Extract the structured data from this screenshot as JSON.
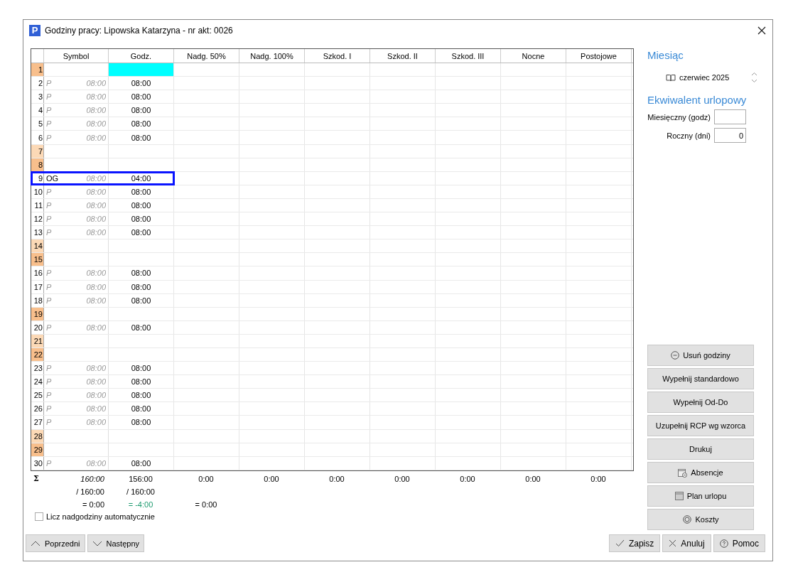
{
  "window": {
    "icon_letter": "P",
    "title": "Godziny pracy: Lipowska Katarzyna - nr akt: 0026"
  },
  "table": {
    "columns": [
      "Symbol",
      "Godz.",
      "Nadg. 50%",
      "Nadg. 100%",
      "Szkod. I",
      "Szkod. II",
      "Szkod. III",
      "Nocne",
      "Postojowe"
    ],
    "rows": [
      {
        "day": "1",
        "kind": "sunday",
        "selected": false,
        "focused": true
      },
      {
        "day": "2",
        "kind": "work",
        "symbol": "P",
        "symbol_entered": false,
        "plan": "08:00",
        "hours": "08:00",
        "selected": false,
        "focused": false
      },
      {
        "day": "3",
        "kind": "work",
        "symbol": "P",
        "symbol_entered": false,
        "plan": "08:00",
        "hours": "08:00",
        "selected": false,
        "focused": false
      },
      {
        "day": "4",
        "kind": "work",
        "symbol": "P",
        "symbol_entered": false,
        "plan": "08:00",
        "hours": "08:00",
        "selected": false,
        "focused": false
      },
      {
        "day": "5",
        "kind": "work",
        "symbol": "P",
        "symbol_entered": false,
        "plan": "08:00",
        "hours": "08:00",
        "selected": false,
        "focused": false
      },
      {
        "day": "6",
        "kind": "work",
        "symbol": "P",
        "symbol_entered": false,
        "plan": "08:00",
        "hours": "08:00",
        "selected": false,
        "focused": false
      },
      {
        "day": "7",
        "kind": "saturday",
        "selected": false,
        "focused": false
      },
      {
        "day": "8",
        "kind": "sunday",
        "selected": false,
        "focused": false
      },
      {
        "day": "9",
        "kind": "work",
        "symbol": "OG",
        "symbol_entered": true,
        "plan": "08:00",
        "hours": "04:00",
        "selected": true,
        "focused": false
      },
      {
        "day": "10",
        "kind": "work",
        "symbol": "P",
        "symbol_entered": false,
        "plan": "08:00",
        "hours": "08:00",
        "selected": false,
        "focused": false
      },
      {
        "day": "11",
        "kind": "work",
        "symbol": "P",
        "symbol_entered": false,
        "plan": "08:00",
        "hours": "08:00",
        "selected": false,
        "focused": false
      },
      {
        "day": "12",
        "kind": "work",
        "symbol": "P",
        "symbol_entered": false,
        "plan": "08:00",
        "hours": "08:00",
        "selected": false,
        "focused": false
      },
      {
        "day": "13",
        "kind": "work",
        "symbol": "P",
        "symbol_entered": false,
        "plan": "08:00",
        "hours": "08:00",
        "selected": false,
        "focused": false
      },
      {
        "day": "14",
        "kind": "saturday",
        "selected": false,
        "focused": false
      },
      {
        "day": "15",
        "kind": "sunday",
        "selected": false,
        "focused": false
      },
      {
        "day": "16",
        "kind": "work",
        "symbol": "P",
        "symbol_entered": false,
        "plan": "08:00",
        "hours": "08:00",
        "selected": false,
        "focused": false
      },
      {
        "day": "17",
        "kind": "work",
        "symbol": "P",
        "symbol_entered": false,
        "plan": "08:00",
        "hours": "08:00",
        "selected": false,
        "focused": false
      },
      {
        "day": "18",
        "kind": "work",
        "symbol": "P",
        "symbol_entered": false,
        "plan": "08:00",
        "hours": "08:00",
        "selected": false,
        "focused": false
      },
      {
        "day": "19",
        "kind": "holiday",
        "selected": false,
        "focused": false
      },
      {
        "day": "20",
        "kind": "work",
        "symbol": "P",
        "symbol_entered": false,
        "plan": "08:00",
        "hours": "08:00",
        "selected": false,
        "focused": false
      },
      {
        "day": "21",
        "kind": "saturday",
        "selected": false,
        "focused": false
      },
      {
        "day": "22",
        "kind": "sunday",
        "selected": false,
        "focused": false
      },
      {
        "day": "23",
        "kind": "work",
        "symbol": "P",
        "symbol_entered": false,
        "plan": "08:00",
        "hours": "08:00",
        "selected": false,
        "focused": false
      },
      {
        "day": "24",
        "kind": "work",
        "symbol": "P",
        "symbol_entered": false,
        "plan": "08:00",
        "hours": "08:00",
        "selected": false,
        "focused": false
      },
      {
        "day": "25",
        "kind": "work",
        "symbol": "P",
        "symbol_entered": false,
        "plan": "08:00",
        "hours": "08:00",
        "selected": false,
        "focused": false
      },
      {
        "day": "26",
        "kind": "work",
        "symbol": "P",
        "symbol_entered": false,
        "plan": "08:00",
        "hours": "08:00",
        "selected": false,
        "focused": false
      },
      {
        "day": "27",
        "kind": "work",
        "symbol": "P",
        "symbol_entered": false,
        "plan": "08:00",
        "hours": "08:00",
        "selected": false,
        "focused": false
      },
      {
        "day": "28",
        "kind": "saturday",
        "selected": false,
        "focused": false
      },
      {
        "day": "29",
        "kind": "sunday",
        "selected": false,
        "focused": false
      },
      {
        "day": "30",
        "kind": "work",
        "symbol": "P",
        "symbol_entered": false,
        "plan": "08:00",
        "hours": "08:00",
        "selected": false,
        "focused": false
      }
    ]
  },
  "summary": {
    "sigma": "Σ",
    "totals": [
      "160:00",
      "156:00",
      "0:00",
      "0:00",
      "0:00",
      "0:00",
      "0:00",
      "0:00",
      "0:00"
    ],
    "norms": [
      "/ 160:00",
      "/ 160:00"
    ],
    "diffs": [
      {
        "text": "= 0:00",
        "color": "#000000"
      },
      {
        "text": "= -4:00",
        "color": "#1c9a6e"
      },
      {
        "text": "= 0:00",
        "color": "#000000"
      }
    ]
  },
  "auto_overtime": {
    "label": "Licz nadgodziny automatycznie",
    "checked": false
  },
  "month": {
    "heading": "Miesiąc",
    "value": "czerwiec 2025"
  },
  "vacation_equivalent": {
    "heading": "Ekwiwalent urlopowy",
    "fields": [
      {
        "label": "Miesięczny (godz)"
      },
      {
        "label": "Roczny (dni)",
        "value": "0"
      }
    ]
  },
  "actions": [
    "Usuń godziny",
    "Wypełnij standardowo",
    "Wypełnij Od-Do",
    "Uzupełnij RCP wg wzorca",
    "Drukuj",
    "Absencje",
    "Plan urlopu",
    "Koszty"
  ],
  "nav_buttons": [
    "Poprzedni",
    "Następny"
  ],
  "dialog_buttons": [
    "Zapisz",
    "Anuluj",
    "Pomoc"
  ]
}
